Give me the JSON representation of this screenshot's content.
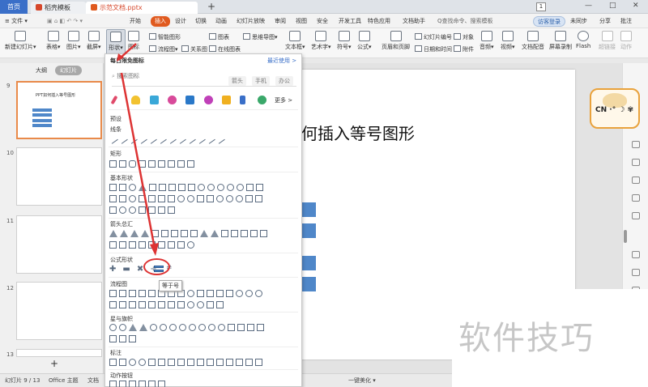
{
  "tabs": {
    "home": "首页",
    "template": "稻壳模板",
    "doc": "示范文档.pptx",
    "add": "+"
  },
  "window": {
    "num": "1",
    "min": "—",
    "max": "□",
    "close": "✕"
  },
  "menu": {
    "file": "≡ 文件 ▾",
    "items": [
      "开始",
      "插入",
      "设计",
      "切换",
      "动画",
      "幻灯片放映",
      "审阅",
      "视图",
      "安全",
      "开发工具",
      "特色应用",
      "文档助手"
    ],
    "search": "Q查找命令、搜索模板",
    "login": "访客登录",
    "unsync": "未同步",
    "share": "分享",
    "comment": "批注"
  },
  "ribbon": {
    "new_slide": "新建幻灯片▾",
    "table": "表格▾",
    "picture": "图片▾",
    "screenshot": "截屏▾",
    "shape": "形状▾",
    "icon": "图标",
    "smart_graph": "智能图形",
    "chart": "图表",
    "mindmap": "思维导图▾",
    "flowchart": "流程图▾",
    "relation": "关系图",
    "online_chart": "在线图表",
    "textbox": "文本框▾",
    "art": "艺术字▾",
    "symbol": "符号▾",
    "formula": "公式▾",
    "header_footer": "页眉和页脚",
    "slide_num": "幻灯片编号",
    "date_time": "日期和时间",
    "object": "对象",
    "attach": "附件",
    "audio": "音频▾",
    "video": "视频▾",
    "doc_music": "文档配音",
    "screen_rec": "屏幕录制",
    "flash": "Flash",
    "hyperlink": "超链接",
    "action": "动作"
  },
  "left_panel": {
    "outline": "大纲",
    "slides": "幻灯片",
    "thumbs": [
      {
        "num": "9",
        "title": "PPT如何插入等号图形"
      },
      {
        "num": "10",
        "title": ""
      },
      {
        "num": "11",
        "title": ""
      },
      {
        "num": "12",
        "title": ""
      },
      {
        "num": "13",
        "title": ""
      }
    ],
    "add": "+"
  },
  "slide": {
    "title": "何插入等号图形"
  },
  "dropdown": {
    "header": "每日限免图标",
    "recent": "最近使用 >",
    "search_placeholder": "搜索图标",
    "chips": [
      "箭头",
      "手机",
      "办公"
    ],
    "more": "更多 >",
    "sections": [
      "预设",
      "线条",
      "矩形",
      "基本形状",
      "箭头总汇",
      "公式形状",
      "流程图",
      "星与旗帜",
      "标注",
      "动作按钮"
    ],
    "tooltip": "等于号"
  },
  "status": {
    "slide_info": "幻灯片 9 / 13",
    "theme": "Office 主题",
    "doc_lock": "文档",
    "beautify": "一键美化 ▾"
  },
  "badge": {
    "text": "CN ·° ☽ ✾"
  },
  "watermark": {
    "text": "软件技巧"
  },
  "colors": {
    "accent": "#e05a1f",
    "blue": "#3a6fc8",
    "shape_blue": "#4f87c9",
    "highlight": "#d33333"
  }
}
